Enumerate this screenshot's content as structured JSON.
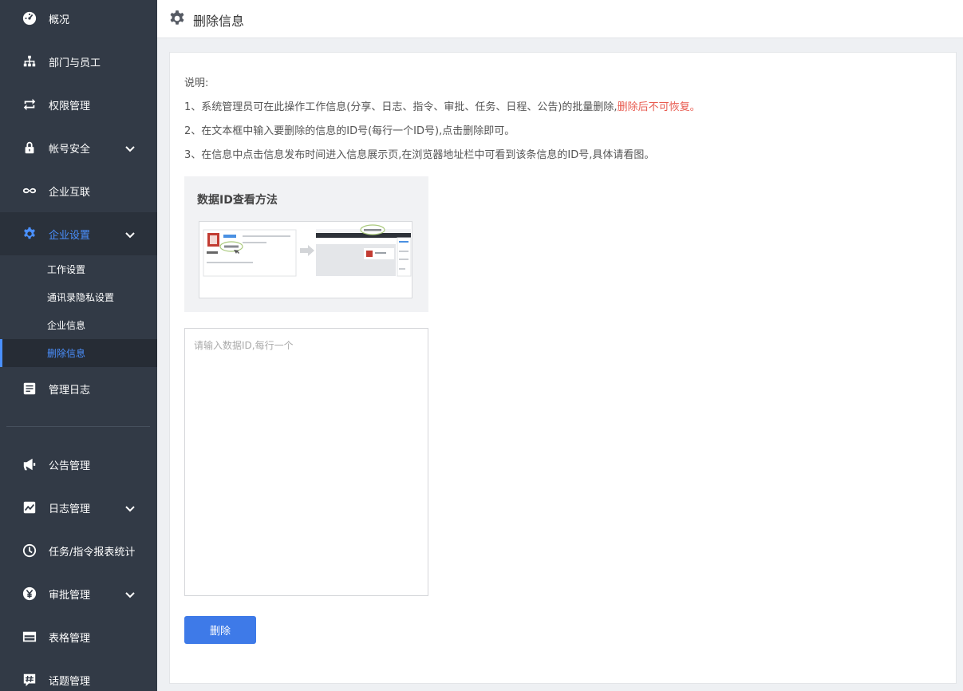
{
  "sidebar": {
    "items": [
      {
        "label": "概况",
        "icon": "dashboard-icon"
      },
      {
        "label": "部门与员工",
        "icon": "org-chart-icon"
      },
      {
        "label": "权限管理",
        "icon": "swap-icon"
      },
      {
        "label": "帐号安全",
        "icon": "lock-icon",
        "expandable": true
      },
      {
        "label": "企业互联",
        "icon": "infinity-icon"
      },
      {
        "label": "企业设置",
        "icon": "gear-icon",
        "expandable": true,
        "active": true
      },
      {
        "label": "管理日志",
        "icon": "log-icon"
      },
      {
        "label": "公告管理",
        "icon": "megaphone-icon"
      },
      {
        "label": "日志管理",
        "icon": "chart-icon",
        "expandable": true
      },
      {
        "label": "任务/指令报表统计",
        "icon": "clock-icon"
      },
      {
        "label": "审批管理",
        "icon": "yen-icon",
        "expandable": true
      },
      {
        "label": "表格管理",
        "icon": "table-icon"
      },
      {
        "label": "话题管理",
        "icon": "hashtag-icon"
      }
    ],
    "sub_items": [
      {
        "label": "工作设置"
      },
      {
        "label": "通讯录隐私设置"
      },
      {
        "label": "企业信息"
      },
      {
        "label": "删除信息",
        "selected": true
      }
    ]
  },
  "header": {
    "title": "删除信息",
    "icon": "gear-icon"
  },
  "main": {
    "desc_title": "说明:",
    "line1_text": "1、系统管理员可在此操作工作信息(分享、日志、指令、审批、任务、日程、公告)的批量删除,",
    "line1_warning": "删除后不可恢复。",
    "line2": "2、在文本框中输入要删除的信息的ID号(每行一个ID号),点击删除即可。",
    "line3": "3、在信息中点击信息发布时间进入信息展示页,在浏览器地址栏中可看到该条信息的ID号,具体请看图。",
    "howto_title": "数据ID查看方法",
    "textarea_value": "",
    "textarea_placeholder": "请输入数据ID,每行一个",
    "delete_button": "删除"
  },
  "colors": {
    "sidebar_bg": "#323a46",
    "accent": "#4a90ff",
    "button": "#3e7ae8",
    "warning": "#e85a4f"
  }
}
